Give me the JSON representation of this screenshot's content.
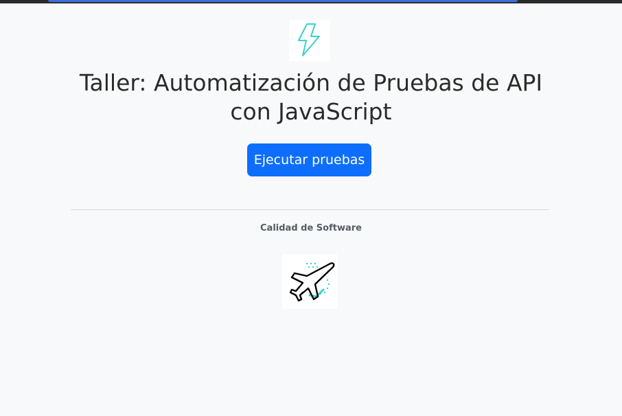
{
  "header": {
    "logo_icon": "lightning-bolt-icon",
    "title": "Taller: Automatización de Pruebas de API con JavaScript"
  },
  "main": {
    "run_button_label": "Ejecutar pruebas"
  },
  "footer": {
    "text": "Calidad de Software",
    "image_icon": "airplane-icon"
  },
  "colors": {
    "accent": "#0d6efd",
    "background": "#f8f9fa",
    "bolt": "#3ccfcf"
  }
}
